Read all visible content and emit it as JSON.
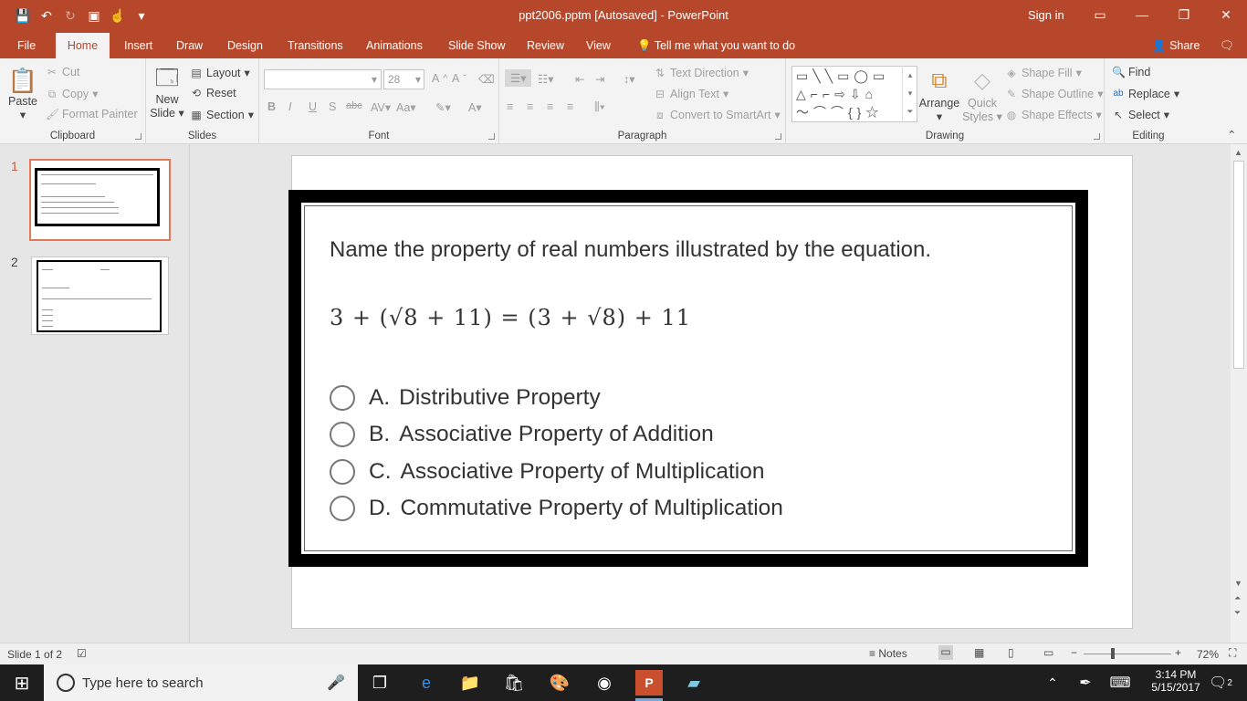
{
  "window": {
    "title": "ppt2006.pptm [Autosaved] - PowerPoint",
    "signin": "Sign in"
  },
  "tabs": [
    "File",
    "Home",
    "Insert",
    "Draw",
    "Design",
    "Transitions",
    "Animations",
    "Slide Show",
    "Review",
    "View"
  ],
  "tell_me": "Tell me what you want to do",
  "share": "Share",
  "ribbon": {
    "clipboard": {
      "paste": "Paste",
      "cut": "Cut",
      "copy": "Copy",
      "format_painter": "Format Painter",
      "label": "Clipboard"
    },
    "slides": {
      "new_slide_1": "New",
      "new_slide_2": "Slide",
      "layout": "Layout",
      "reset": "Reset",
      "section": "Section",
      "label": "Slides"
    },
    "font": {
      "size": "28",
      "bold": "B",
      "italic": "I",
      "underline": "U",
      "shadow": "S",
      "strike": "abc",
      "label": "Font"
    },
    "paragraph": {
      "text_direction": "Text Direction",
      "align_text": "Align Text",
      "convert_smartart": "Convert to SmartArt",
      "label": "Paragraph"
    },
    "drawing": {
      "arrange": "Arrange",
      "quick_styles_1": "Quick",
      "quick_styles_2": "Styles",
      "shape_fill": "Shape Fill",
      "shape_outline": "Shape Outline",
      "shape_effects": "Shape Effects",
      "label": "Drawing"
    },
    "editing": {
      "find": "Find",
      "replace": "Replace",
      "select": "Select",
      "label": "Editing"
    }
  },
  "thumbnails": [
    {
      "number": "1"
    },
    {
      "number": "2"
    }
  ],
  "slide": {
    "question": "Name the property of real numbers illustrated by the equation.",
    "equation": "3 + (√8 + 11) = (3 + √8) + 11",
    "options": [
      {
        "letter": "A.",
        "text": "Distributive Property"
      },
      {
        "letter": "B.",
        "text": "Associative Property of Addition"
      },
      {
        "letter": "C.",
        "text": "Associative Property of Multiplication"
      },
      {
        "letter": "D.",
        "text": "Commutative Property of Multiplication"
      }
    ]
  },
  "status": {
    "slide_of": "Slide 1 of 2",
    "notes": "Notes",
    "zoom": "72%"
  },
  "taskbar": {
    "search_placeholder": "Type here to search",
    "time": "3:14 PM",
    "date": "5/15/2017",
    "notifications": "2"
  }
}
